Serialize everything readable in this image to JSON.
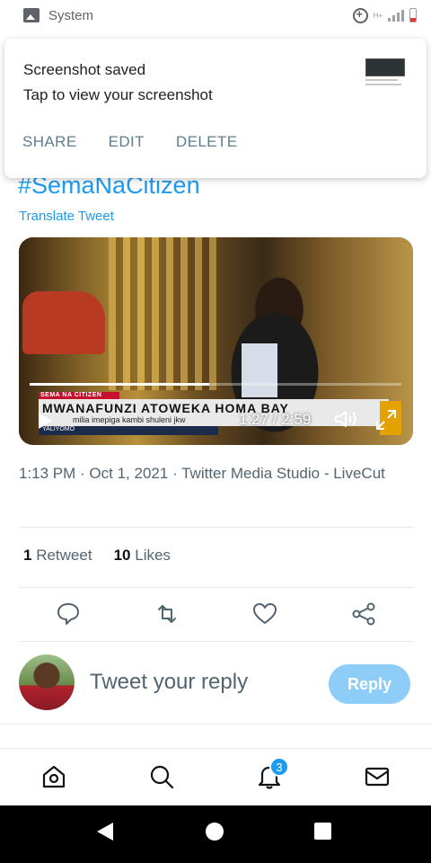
{
  "status_bar": {
    "app_name": "System",
    "network_label": "H+"
  },
  "notification": {
    "title": "Screenshot saved",
    "text": "Tap to view your screenshot",
    "actions": [
      "SHARE",
      "EDIT",
      "DELETE"
    ]
  },
  "tweet": {
    "hashtag": "#SemaNaCitizen",
    "translate_label": "Translate Tweet",
    "video": {
      "ticker_header": "SEMA NA CITIZEN",
      "ticker_headline": "MWANAFUNZI ATOWEKA HOMA BAY",
      "ticker_subtext": "milia imepiga kambi shuleni jkw",
      "ticker_bottom": "YALIYOMO",
      "time_label": "1:27 / 2:59",
      "progress_fraction": 0.484
    },
    "meta": "1:13 PM · Oct 1, 2021 · Twitter Media Studio - LiveCut",
    "retweets_count": "1",
    "retweets_label": "Retweet",
    "likes_count": "10",
    "likes_label": "Likes"
  },
  "reply": {
    "placeholder": "Tweet your reply",
    "button_label": "Reply"
  },
  "bottom_nav": {
    "notifications_badge": "3"
  },
  "colors": {
    "accent": "#1d9bf0",
    "reply_button_disabled": "#8ecdf7",
    "secondary_text": "#536471",
    "notification_action": "#607d8b"
  },
  "icons": {
    "status_app": "image-icon",
    "reply": "comment-icon",
    "retweet": "retweet-icon",
    "like": "heart-icon",
    "share": "share-icon",
    "home": "home-icon",
    "search": "search-icon",
    "notifications": "bell-icon",
    "messages": "mail-icon"
  }
}
